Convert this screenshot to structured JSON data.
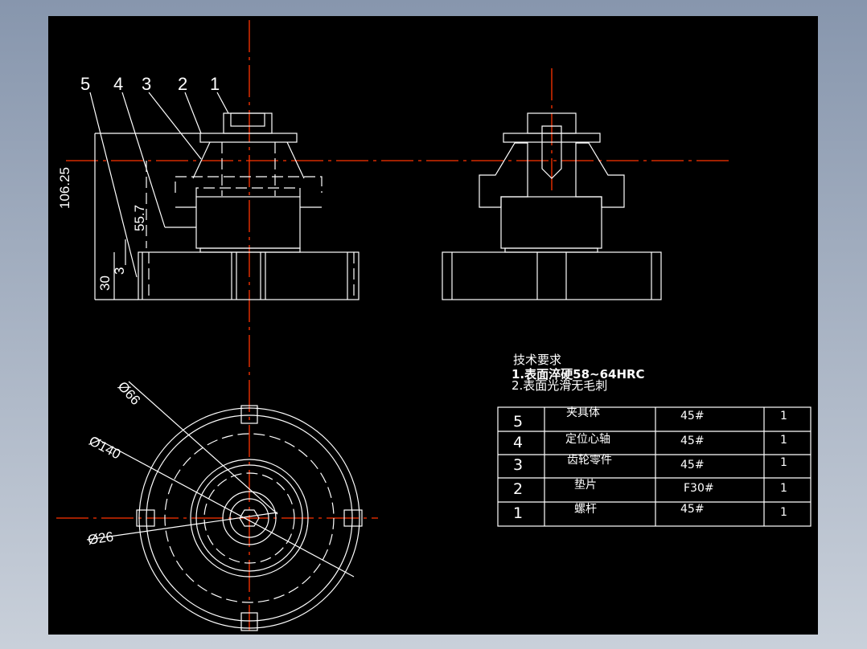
{
  "drawing": {
    "part_labels": [
      "5",
      "4",
      "3",
      "2",
      "1"
    ],
    "dimensions": {
      "overall_height": "106.25",
      "gear_height": "55.7",
      "base_height": "30",
      "plate_thickness": "3",
      "d_66": "Ø66",
      "d_140": "Ø140",
      "d_26": "Ø26"
    },
    "colors": {
      "background": "#000000",
      "lines": "#ffffff",
      "centerline": "#ff3300"
    }
  },
  "notes": {
    "title": "技术要求",
    "items": [
      "1.表面淬硬58~64HRC",
      "2.表面光滑无毛刺"
    ]
  },
  "parts_table": {
    "rows": [
      {
        "no": "5",
        "name": "夹具体",
        "material": "45#",
        "qty": "1"
      },
      {
        "no": "4",
        "name": "定位心轴",
        "material": "45#",
        "qty": "1"
      },
      {
        "no": "3",
        "name": "齿轮零件",
        "material": "45#",
        "qty": "1"
      },
      {
        "no": "2",
        "name": "垫片",
        "material": "F30#",
        "qty": "1"
      },
      {
        "no": "1",
        "name": "螺杆",
        "material": "45#",
        "qty": "1"
      }
    ]
  }
}
